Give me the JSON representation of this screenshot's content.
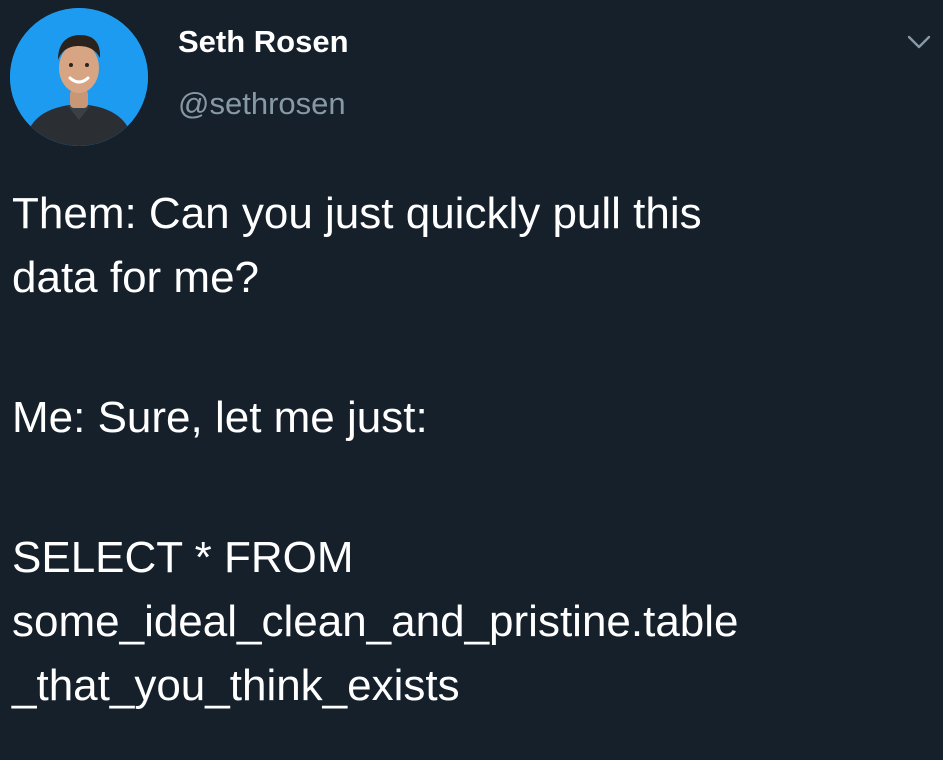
{
  "author": {
    "display_name": "Seth Rosen",
    "handle": "@sethrosen",
    "avatar_icon": "profile-photo",
    "avatar_bg": "#1d9bf0"
  },
  "menu": {
    "icon": "chevron-down-icon"
  },
  "tweet": {
    "paragraphs": [
      {
        "lines": [
          "Them: Can you just quickly pull this",
          "data for me?"
        ]
      },
      {
        "lines": [
          "Me: Sure, let me just:"
        ]
      },
      {
        "lines": [
          "SELECT * FROM",
          "some_ideal_clean_and_pristine.table",
          "_that_you_think_exists"
        ]
      }
    ]
  },
  "colors": {
    "background": "#15202b",
    "primary_text": "#ffffff",
    "secondary_text": "#8899a6"
  }
}
